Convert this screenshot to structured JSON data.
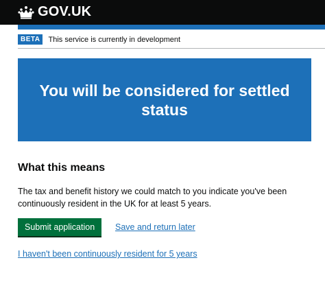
{
  "header": {
    "logo_text": "GOV.UK",
    "crown_icon": "crown-icon"
  },
  "phase_banner": {
    "tag": "BETA",
    "text": "This service is currently in development"
  },
  "panel": {
    "title": "You will be considered for settled status"
  },
  "content": {
    "heading": "What this means",
    "paragraph": "The tax and benefit history we could match to you indicate you've been continuously resident in the UK for at least 5 years."
  },
  "actions": {
    "submit_label": "Submit application",
    "save_label": "Save and return later",
    "not_resident_label": "I haven't been continuously resident for 5 years"
  },
  "colors": {
    "header_bg": "#0b0c0c",
    "brand_blue": "#1d70b8",
    "button_green": "#00703c",
    "text": "#0b0c0c"
  }
}
